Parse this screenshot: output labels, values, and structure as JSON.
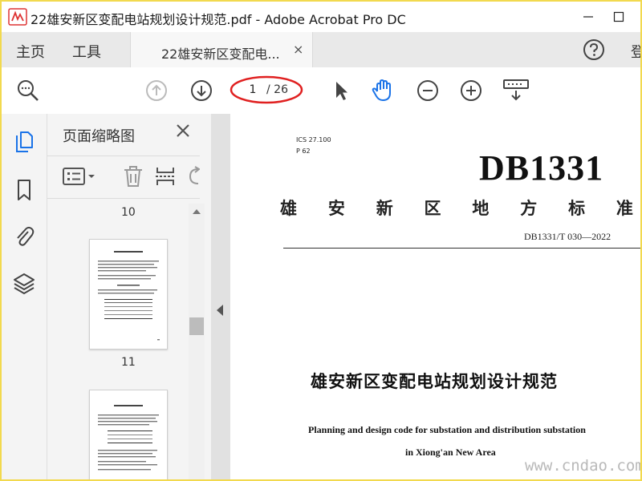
{
  "window": {
    "title": "22雄安新区变配电站规划设计规范.pdf - Adobe Acrobat Pro DC"
  },
  "menu": {
    "home": "主页",
    "tools": "工具",
    "doc_tab": "22雄安新区变配电...",
    "doc_tab_close": "×",
    "signin": "登"
  },
  "toolbar": {
    "current_page": "1",
    "total_pages": "/ 26",
    "icons": [
      "zoom-search-icon",
      "prev-page-icon",
      "next-page-icon",
      "select-arrow-icon",
      "hand-tool-icon",
      "zoom-out-icon",
      "zoom-in-icon",
      "keyboard-icon"
    ]
  },
  "left_rail": {
    "icons": [
      "page-thumbnails-icon",
      "bookmark-icon",
      "attachment-icon",
      "layers-icon"
    ]
  },
  "thumbnail_panel": {
    "title": "页面缩略图",
    "page_labels": [
      "10",
      "11"
    ]
  },
  "document": {
    "ics": "ICS 27.100",
    "category": "P 62",
    "standard_code": "DB1331",
    "standard_type": [
      "雄",
      "安",
      "新",
      "区",
      "地",
      "方",
      "标",
      "准"
    ],
    "standard_number": "DB1331/T 030—2022",
    "cn_title": "雄安新区变配电站规划设计规范",
    "en_title_line1": "Planning and design code for substation and distribution substation",
    "en_title_line2": "in Xiong'an New Area"
  },
  "watermark": "www.cndao.com",
  "colors": {
    "accent_blue": "#1a73e8",
    "annotation_red": "#e02020",
    "frame_yellow": "#f2d94e"
  }
}
